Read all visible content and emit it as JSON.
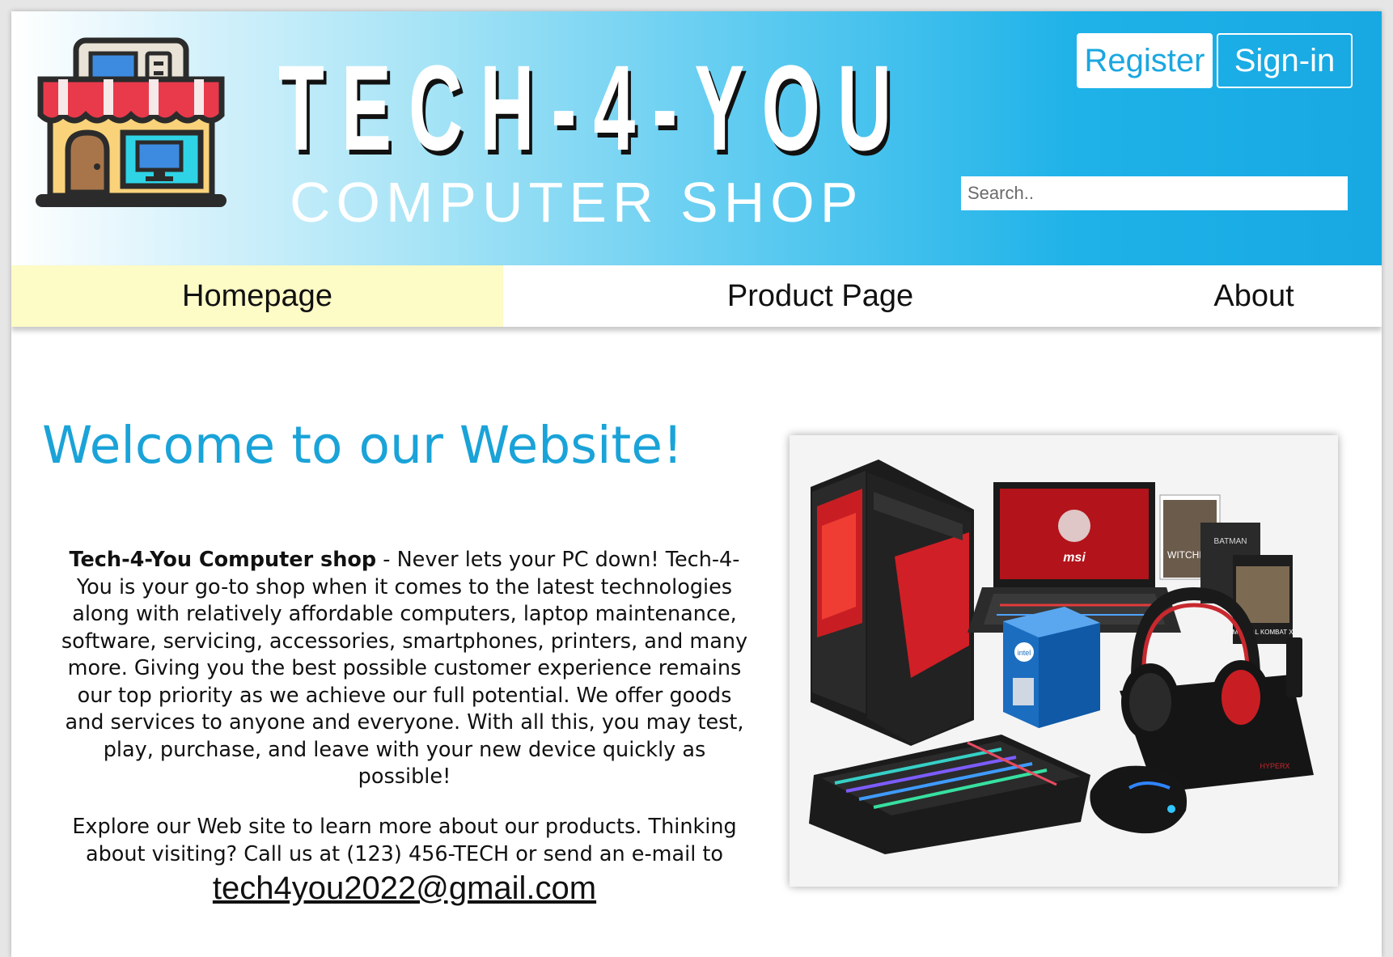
{
  "header": {
    "brand": "TECH-4-YOU",
    "tagline": "COMPUTER SHOP",
    "register_label": "Register",
    "signin_label": "Sign-in",
    "search_placeholder": "Search.."
  },
  "nav": {
    "items": [
      {
        "label": "Homepage",
        "active": true
      },
      {
        "label": "Product Page",
        "active": false
      },
      {
        "label": "About",
        "active": false
      }
    ]
  },
  "main": {
    "welcome": "Welcome to our Website!",
    "intro_bold": "Tech-4-You Computer shop",
    "intro_text": " - Never lets your PC down! Tech-4-You is your go-to shop when it comes to the latest technologies along with relatively affordable computers, laptop maintenance, software, servicing, accessories, smartphones, printers, and many more. Giving you the best possible customer experience remains our top priority as we achieve our full potential. We offer goods and services to anyone and everyone. With all this, you may test, play, purchase, and leave with your new device quickly as possible!",
    "explore_text": "Explore our Web site to learn more about our products. Thinking about visiting? Call us at (123) 456-TECH or send an e-mail to",
    "email": "tech4you2022@gmail.com"
  },
  "product_image": {
    "laptop_brand": "msi",
    "cpu_brand": "intel",
    "game_box_1": "WITCHER",
    "game_box_2": "BATMAN",
    "game_box_3": "MORTAL KOMBAT X",
    "headset_brand": "HYPERX"
  },
  "colors": {
    "accent": "#1aa7e0",
    "nav_active_bg": "#fdfbc6",
    "welcome_text": "#1aa3d8"
  }
}
